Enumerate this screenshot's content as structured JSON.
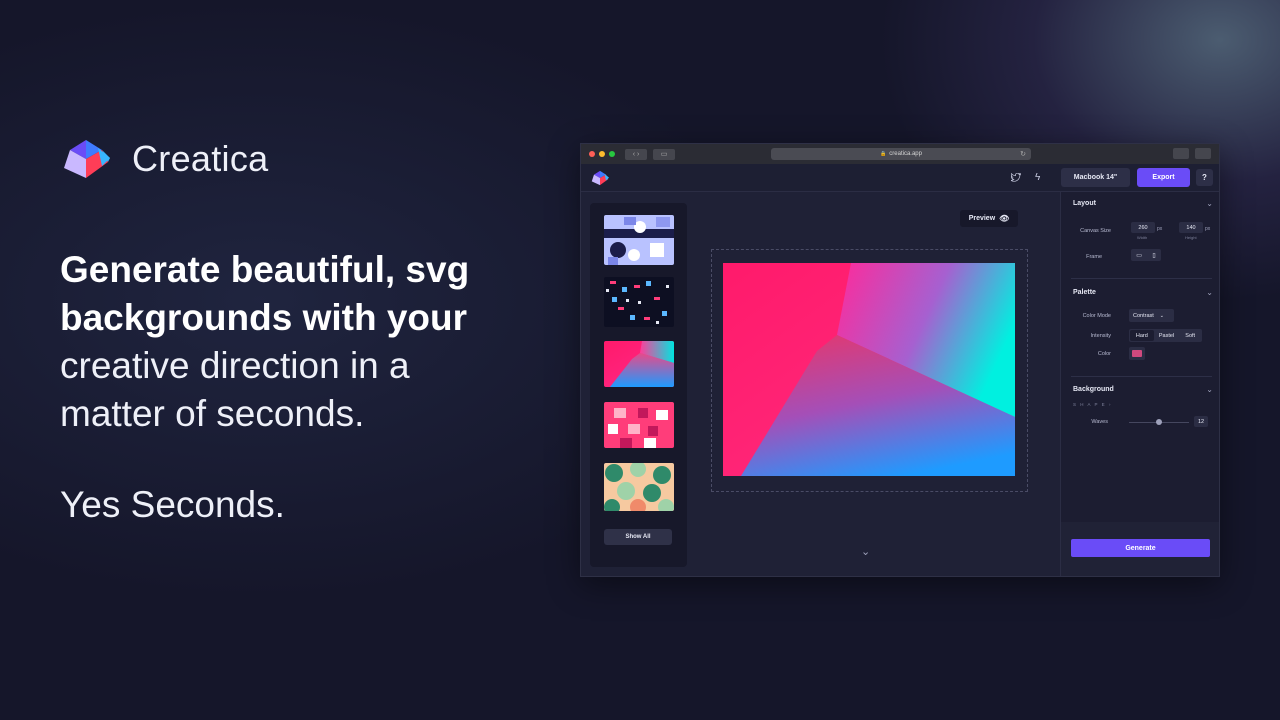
{
  "brand": {
    "name": "Creatica",
    "logo_icon": "creatica-cube-logo",
    "colors": {
      "logo_blue": "#38b6ff",
      "logo_purple": "#6a4cf7",
      "logo_red": "#ff3d57",
      "logo_lilac": "#c9b8ff"
    }
  },
  "hero": {
    "headline_bold_1": "Generate beautiful, svg",
    "headline_bold_2": "backgrounds with your",
    "headline_light_1": "creative direction in a",
    "headline_light_2": "matter of seconds.",
    "tagline": "Yes Seconds."
  },
  "browser": {
    "url": "creatica.app",
    "lock_icon": "lock-icon",
    "reload_icon": "reload-icon"
  },
  "app_header": {
    "twitter_icon": "twitter-icon",
    "bolt_icon": "bolt-icon",
    "device_label": "Macbook 14\"",
    "export_label": "Export",
    "help_label": "?"
  },
  "thumbnails": {
    "show_all_label": "Show All",
    "items": [
      {
        "style": "geometric-lavender"
      },
      {
        "style": "glyph-dark"
      },
      {
        "style": "gradient-pink-blue"
      },
      {
        "style": "tiles-pink"
      },
      {
        "style": "shapes-green-peach"
      }
    ]
  },
  "canvas": {
    "preview_label": "Preview",
    "art_colors": {
      "pink": "#ff1a6b",
      "magenta": "#ff2a8a",
      "cyan": "#00f0e0",
      "blue": "#1e9bff"
    }
  },
  "panel": {
    "layout": {
      "title": "Layout",
      "canvas_size_label": "Canvas Size",
      "width_value": "260",
      "width_sublabel": "Width",
      "height_value": "140",
      "height_sublabel": "Height",
      "unit": "px",
      "frame_label": "Frame"
    },
    "palette": {
      "title": "Palette",
      "color_mode_label": "Color Mode",
      "color_mode_value": "Contrast",
      "intensity_label": "Intensity",
      "intensity_options": [
        "Hard",
        "Pastel",
        "Soft"
      ],
      "intensity_selected": "Hard",
      "color_label": "Color",
      "color_value": "#d0497e"
    },
    "background": {
      "title": "Background",
      "shape_label": "S H A P E",
      "waves_label": "Waves",
      "waves_value": "12"
    },
    "generate_label": "Generate"
  }
}
